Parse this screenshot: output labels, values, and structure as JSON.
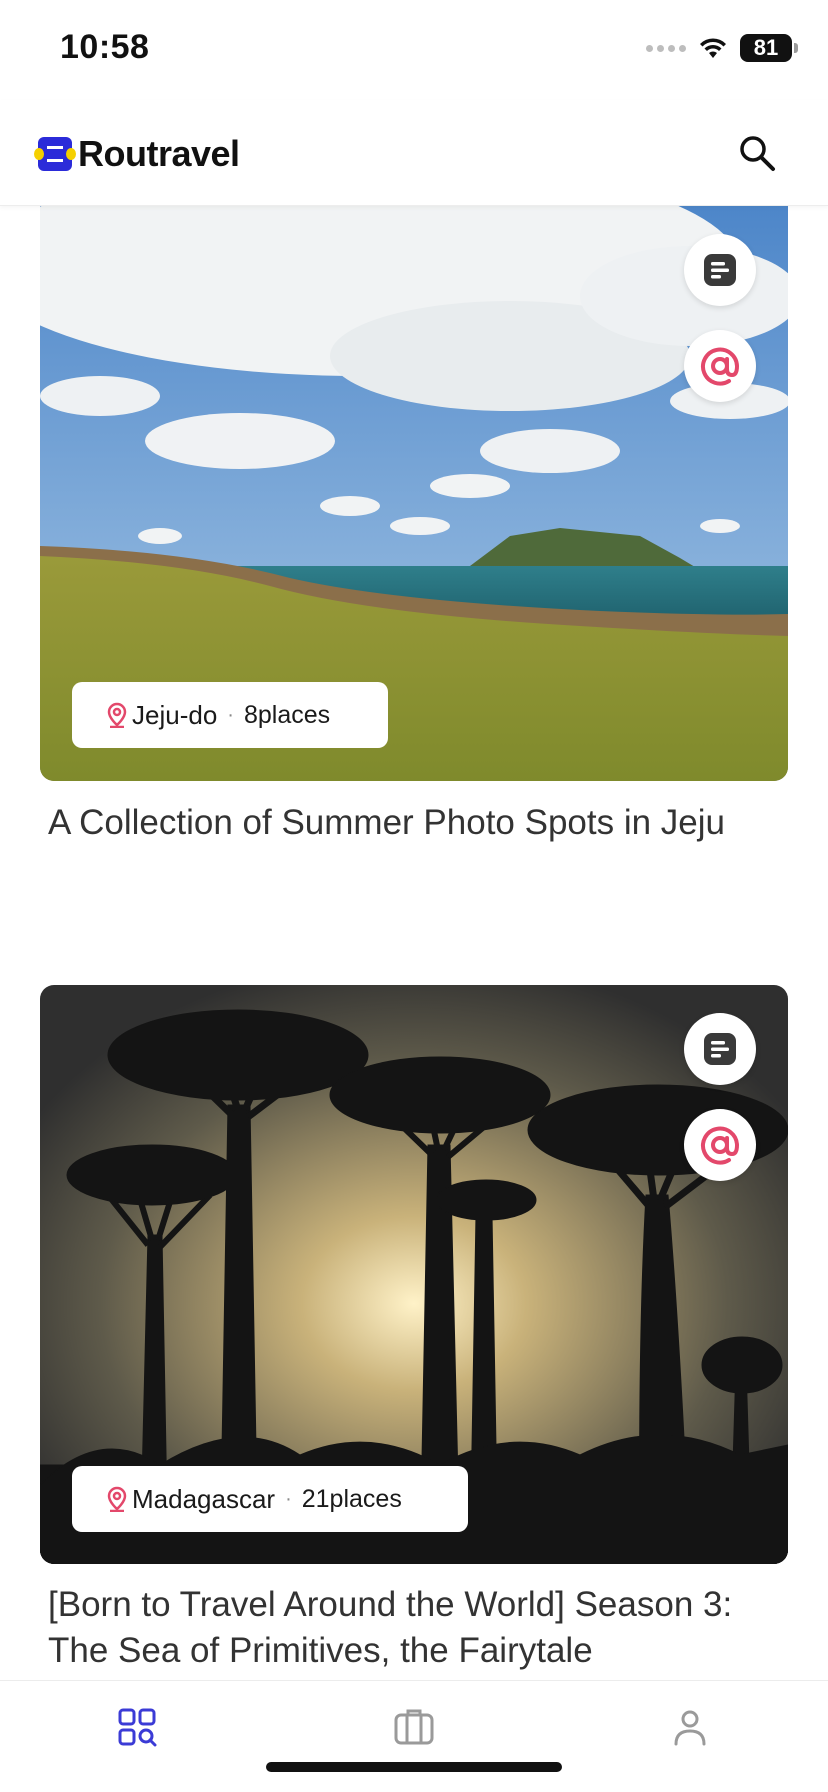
{
  "status_bar": {
    "time": "10:58",
    "battery": "81"
  },
  "header": {
    "brand": "Routravel"
  },
  "posts": [
    {
      "location": "Jeju-do",
      "places": "8places",
      "title": "A Collection of Summer Photo Spots in Jeju"
    },
    {
      "location": "Madagascar",
      "places": "21places",
      "title": "[Born to Travel Around the World] Season 3: The Sea of Primitives, the Fairytale"
    }
  ],
  "icons": {
    "search": "search-icon",
    "post_type": "notes-icon",
    "mention": "at-sign-icon",
    "location": "map-pin-icon",
    "nav_explore": "grid-search-icon",
    "nav_trips": "suitcase-icon",
    "nav_profile": "person-icon"
  },
  "colors": {
    "accent_pink": "#e3486b",
    "nav_active": "#3b3bd6",
    "nav_inactive": "#9a9a9a",
    "brand_blue": "#2b2bd9"
  }
}
